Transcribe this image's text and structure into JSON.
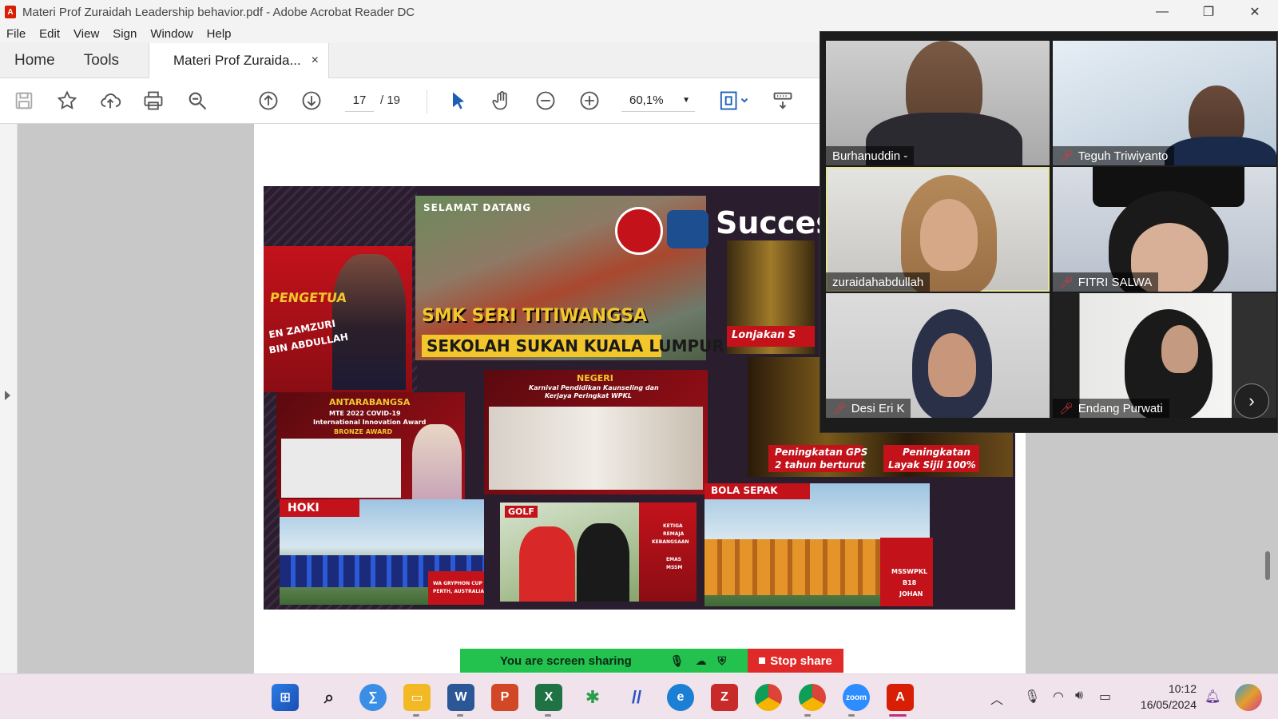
{
  "window": {
    "title": "Materi Prof Zuraidah Leadership behavior.pdf - Adobe Acrobat Reader DC",
    "minimize": "—",
    "maximize": "❐",
    "close": "✕"
  },
  "menu": [
    "File",
    "Edit",
    "View",
    "Sign",
    "Window",
    "Help"
  ],
  "tabs": {
    "home": "Home",
    "tools": "Tools",
    "document": "Materi Prof Zuraida...",
    "close": "×"
  },
  "toolbar": {
    "current_page": "17",
    "total_pages": "/ 19",
    "zoom": "60,1%"
  },
  "slide": {
    "welcome": "SELAMAT DATANG",
    "school_name": "SMK SERI TITIWANGSA",
    "school_sub": "SEKOLAH SUKAN KUALA LUMPUR",
    "success": "Succes",
    "principal_title": "PENGETUA",
    "principal_name_1": "EN ZAMZURI",
    "principal_name_2": "BIN ABDULLAH",
    "intl_title": "ANTARABANGSA",
    "intl_sub_1": "MTE 2022 COVID-19",
    "intl_sub_2": "International Innovation Award",
    "intl_award": "BRONZE AWARD",
    "state_title": "NEGERI",
    "state_sub_1": "Karnival Pendidikan Kaunseling dan",
    "state_sub_2": "Kerjaya Peringkat WPKL",
    "lonjakan": "Lonjakan S",
    "gps_1": "Peningkatan GPS",
    "gps_2": "2 tahun berturut",
    "sijil_1": "Peningkatan",
    "sijil_2": "Layak Sijil 100%",
    "hoki": "HOKI",
    "hoki_cap_1": "WA GRYPHON CUP",
    "hoki_cap_2": "PERTH, AUSTRALIA",
    "golf": "GOLF",
    "golf_cap_1": "KETIGA",
    "golf_cap_2": "REMAJA",
    "golf_cap_3": "KEBANGSAAN",
    "golf_cap_4": "EMAS",
    "golf_cap_5": "MSSM",
    "bola": "BOLA SEPAK",
    "bola_cap_1": "MSSWPKL",
    "bola_cap_2": "B18",
    "bola_cap_3": "JOHAN"
  },
  "participants": [
    {
      "name": "Burhanuddin -",
      "muted": false
    },
    {
      "name": "Teguh Triwiyanto",
      "muted": true
    },
    {
      "name": "zuraidahabdullah",
      "muted": false
    },
    {
      "name": "FITRI SALWA",
      "muted": true
    },
    {
      "name": "Desi Eri K",
      "muted": true
    },
    {
      "name": "Endang Purwati",
      "muted": true
    }
  ],
  "share": {
    "status": "You are screen sharing",
    "stop": "Stop share"
  },
  "taskbar": {
    "time": "10:12",
    "date": "16/05/2024"
  },
  "colors": {
    "acrobat_red": "#d81e05",
    "share_green": "#23c24f",
    "stop_red": "#e02a2a",
    "slide_gold": "#f3c72c"
  }
}
